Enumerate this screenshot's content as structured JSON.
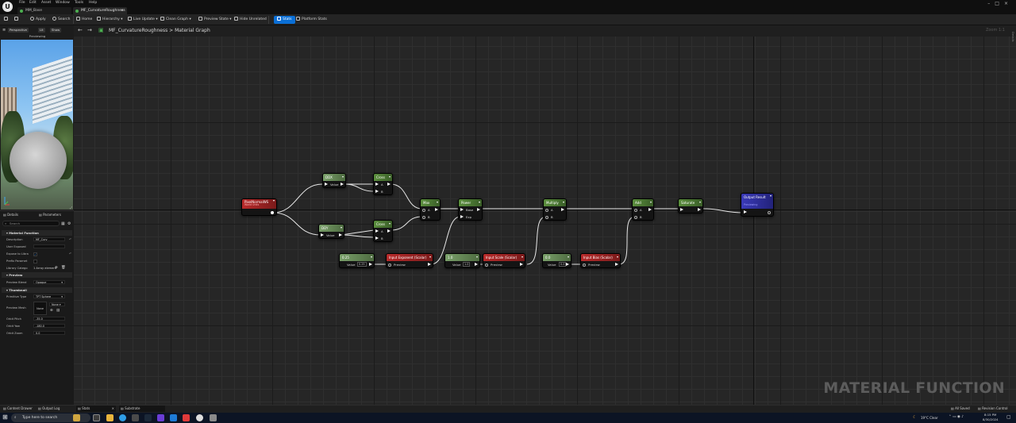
{
  "menu": [
    "File",
    "Edit",
    "Asset",
    "Window",
    "Tools",
    "Help"
  ],
  "tabs": [
    {
      "label": "MM_Base",
      "color": "#4caf50"
    },
    {
      "label": "MF_CurvatureRoughness",
      "color": "#4caf50",
      "close": "×"
    }
  ],
  "toolbar": {
    "apply": "Apply",
    "search": "Search",
    "home": "Home",
    "hierarchy": "Hierarchy",
    "live_update": "Live Update",
    "clean_graph": "Clean Graph",
    "preview_state": "Preview State",
    "hide_unrelated": "Hide Unrelated",
    "stats": "Stats",
    "platform_stats": "Platform Stats"
  },
  "viewport": {
    "perspective": "Perspective",
    "lit": "Lit",
    "show": "Show",
    "previewing": "Previewing"
  },
  "details": {
    "tab_details": "Details",
    "tab_parameters": "Parameters",
    "search_placeholder": "Search",
    "section_material_function": "Material Function",
    "description_label": "Description",
    "description_value": "MF_Curv",
    "user_exposed_label": "User Exposed",
    "expose_to_library_label": "Expose to Libra",
    "prefix_param_label": "Prefix Paramet",
    "library_categ_label": "Library Catego",
    "library_categ_value": "1 Array element",
    "section_preview": "Preview",
    "preview_blend_label": "Preview Blend",
    "preview_blend_value": "Opaque",
    "section_thumbnail": "Thumbnail",
    "primitive_type_label": "Primitive Type",
    "primitive_type_value": "TPT Sphere",
    "preview_mesh_label": "Preview Mesh",
    "preview_mesh_value": "None",
    "preview_mesh_thumb": "None",
    "orbit_pitch_label": "Orbit Pitch",
    "orbit_pitch_value": "-35.0",
    "orbit_yaw_label": "Orbit Yaw",
    "orbit_yaw_value": "-180.0",
    "orbit_zoom_label": "Orbit Zoom",
    "orbit_zoom_value": "0.0"
  },
  "graph": {
    "breadcrumb_asset": "MF_CurvatureRoughness",
    "breadcrumb_sep": ">",
    "breadcrumb_graph": "Material Graph",
    "zoom": "Zoom 1:1",
    "details_side": "Details",
    "watermark": "MATERIAL FUNCTION",
    "nodes": {
      "pixel_normal": {
        "title": "PixelNormalWS",
        "subtitle": "World Units"
      },
      "ddx": {
        "title": "DDX",
        "pin_label": "Value"
      },
      "ddy": {
        "title": "DDY",
        "pin_label": "Value"
      },
      "cross1": {
        "title": "Cross",
        "a": "A",
        "b": "B"
      },
      "cross2": {
        "title": "Cross",
        "a": "A",
        "b": "B"
      },
      "max": {
        "title": "Max",
        "a": "A",
        "b": "B"
      },
      "power": {
        "title": "Power",
        "base": "Base",
        "exp": "Exp"
      },
      "multiply": {
        "title": "Multiply",
        "a": "A",
        "b": "B"
      },
      "add": {
        "title": "Add",
        "a": "A",
        "b": "B"
      },
      "saturate": {
        "title": "Saturate"
      },
      "output": {
        "title": "Output Result",
        "subtitle": "Previewing"
      },
      "const_exp": {
        "title": "0.25",
        "value_label": "Value",
        "value": "0.25"
      },
      "input_exp": {
        "title": "Input Exponent (Scalar)",
        "preview": "Preview"
      },
      "const_scale": {
        "title": "1.0",
        "value_label": "Value",
        "value": "1.0"
      },
      "input_scale": {
        "title": "Input Scale (Scalar)",
        "preview": "Preview"
      },
      "const_bias": {
        "title": "0.0",
        "value_label": "Value",
        "value": "0.0"
      },
      "input_bias": {
        "title": "Input Bias (Scalar)",
        "preview": "Preview"
      }
    }
  },
  "bottom": {
    "content_drawer": "Content Drawer",
    "output_log": "Output Log",
    "stats_tab": "Stats",
    "substrate_tab": "Substrate",
    "all_saved": "All Saved",
    "revision_control": "Revision Control"
  },
  "taskbar": {
    "search": "Type here to search",
    "weather": "19°C Clear",
    "time": "8:15 PM",
    "date": "8/30/2024"
  }
}
